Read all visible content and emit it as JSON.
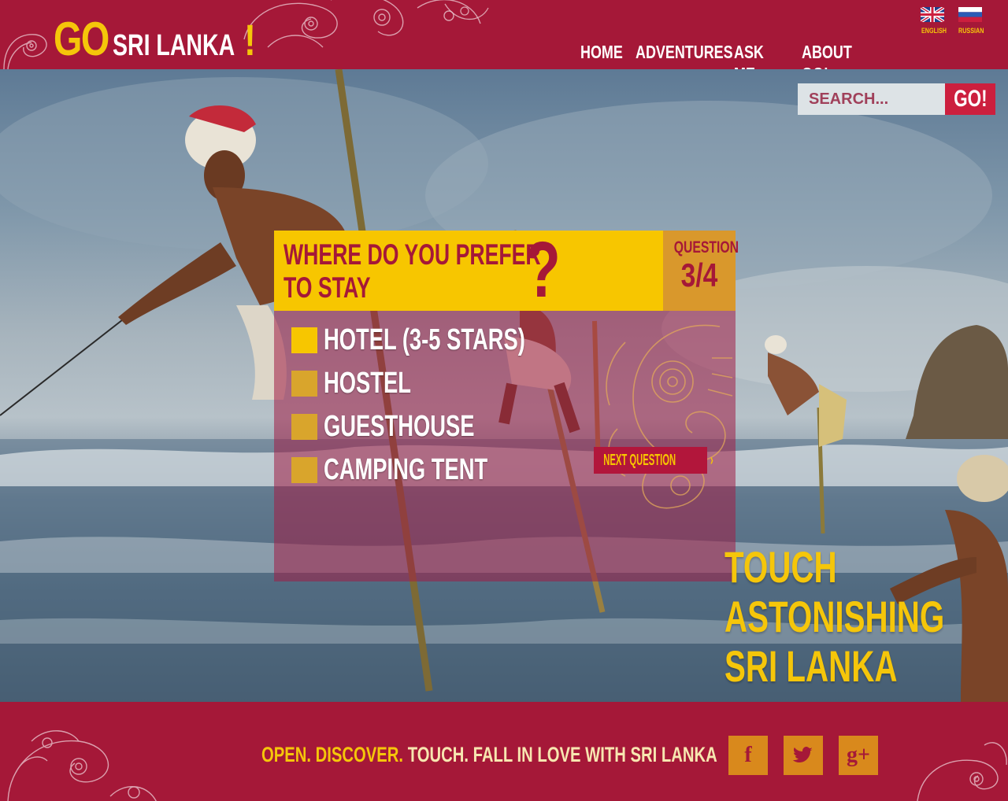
{
  "brand": {
    "go": "GO",
    "name": "SRI LANKA",
    "bang": "!"
  },
  "languages": [
    {
      "label": "ENGLISH",
      "icon": "uk-flag-icon"
    },
    {
      "label": "RUSSIAN",
      "icon": "russia-flag-icon"
    }
  ],
  "nav": [
    "HOME",
    "ADVENTURES",
    "ASK ME",
    "ABOUT GO!"
  ],
  "search": {
    "placeholder": "SEARCH...",
    "button": "GO!"
  },
  "quiz": {
    "question_line1": "WHERE DO YOU PREFER",
    "question_line2": "TO STAY",
    "question_mark": "?",
    "counter_label": "QUESTION",
    "counter_value": "3/4",
    "options": [
      {
        "label": "HOTEL (3-5 STARS)",
        "selected": true
      },
      {
        "label": "HOSTEL",
        "selected": false
      },
      {
        "label": "GUESTHOUSE",
        "selected": false
      },
      {
        "label": "CAMPING TENT",
        "selected": false
      }
    ],
    "next_label": "NEXT QUESTION",
    "next_icon": "›"
  },
  "tagline": [
    "TOUCH",
    "ASTONISHING",
    "SRI LANKA"
  ],
  "footer": {
    "slogan_open": "OPEN.",
    "slogan_discover": "DISCOVER.",
    "slogan_touch": "TOUCH.",
    "slogan_rest": "FALL IN LOVE WITH SRI LANKA",
    "social": [
      {
        "glyph": "f",
        "icon": "facebook-icon"
      },
      {
        "glyph": "t",
        "icon": "twitter-icon"
      },
      {
        "glyph": "g+",
        "icon": "google-plus-icon"
      }
    ]
  },
  "colors": {
    "brand_red": "#a51838",
    "brand_yellow": "#f5c60a",
    "accent_orange": "#d9891c"
  }
}
